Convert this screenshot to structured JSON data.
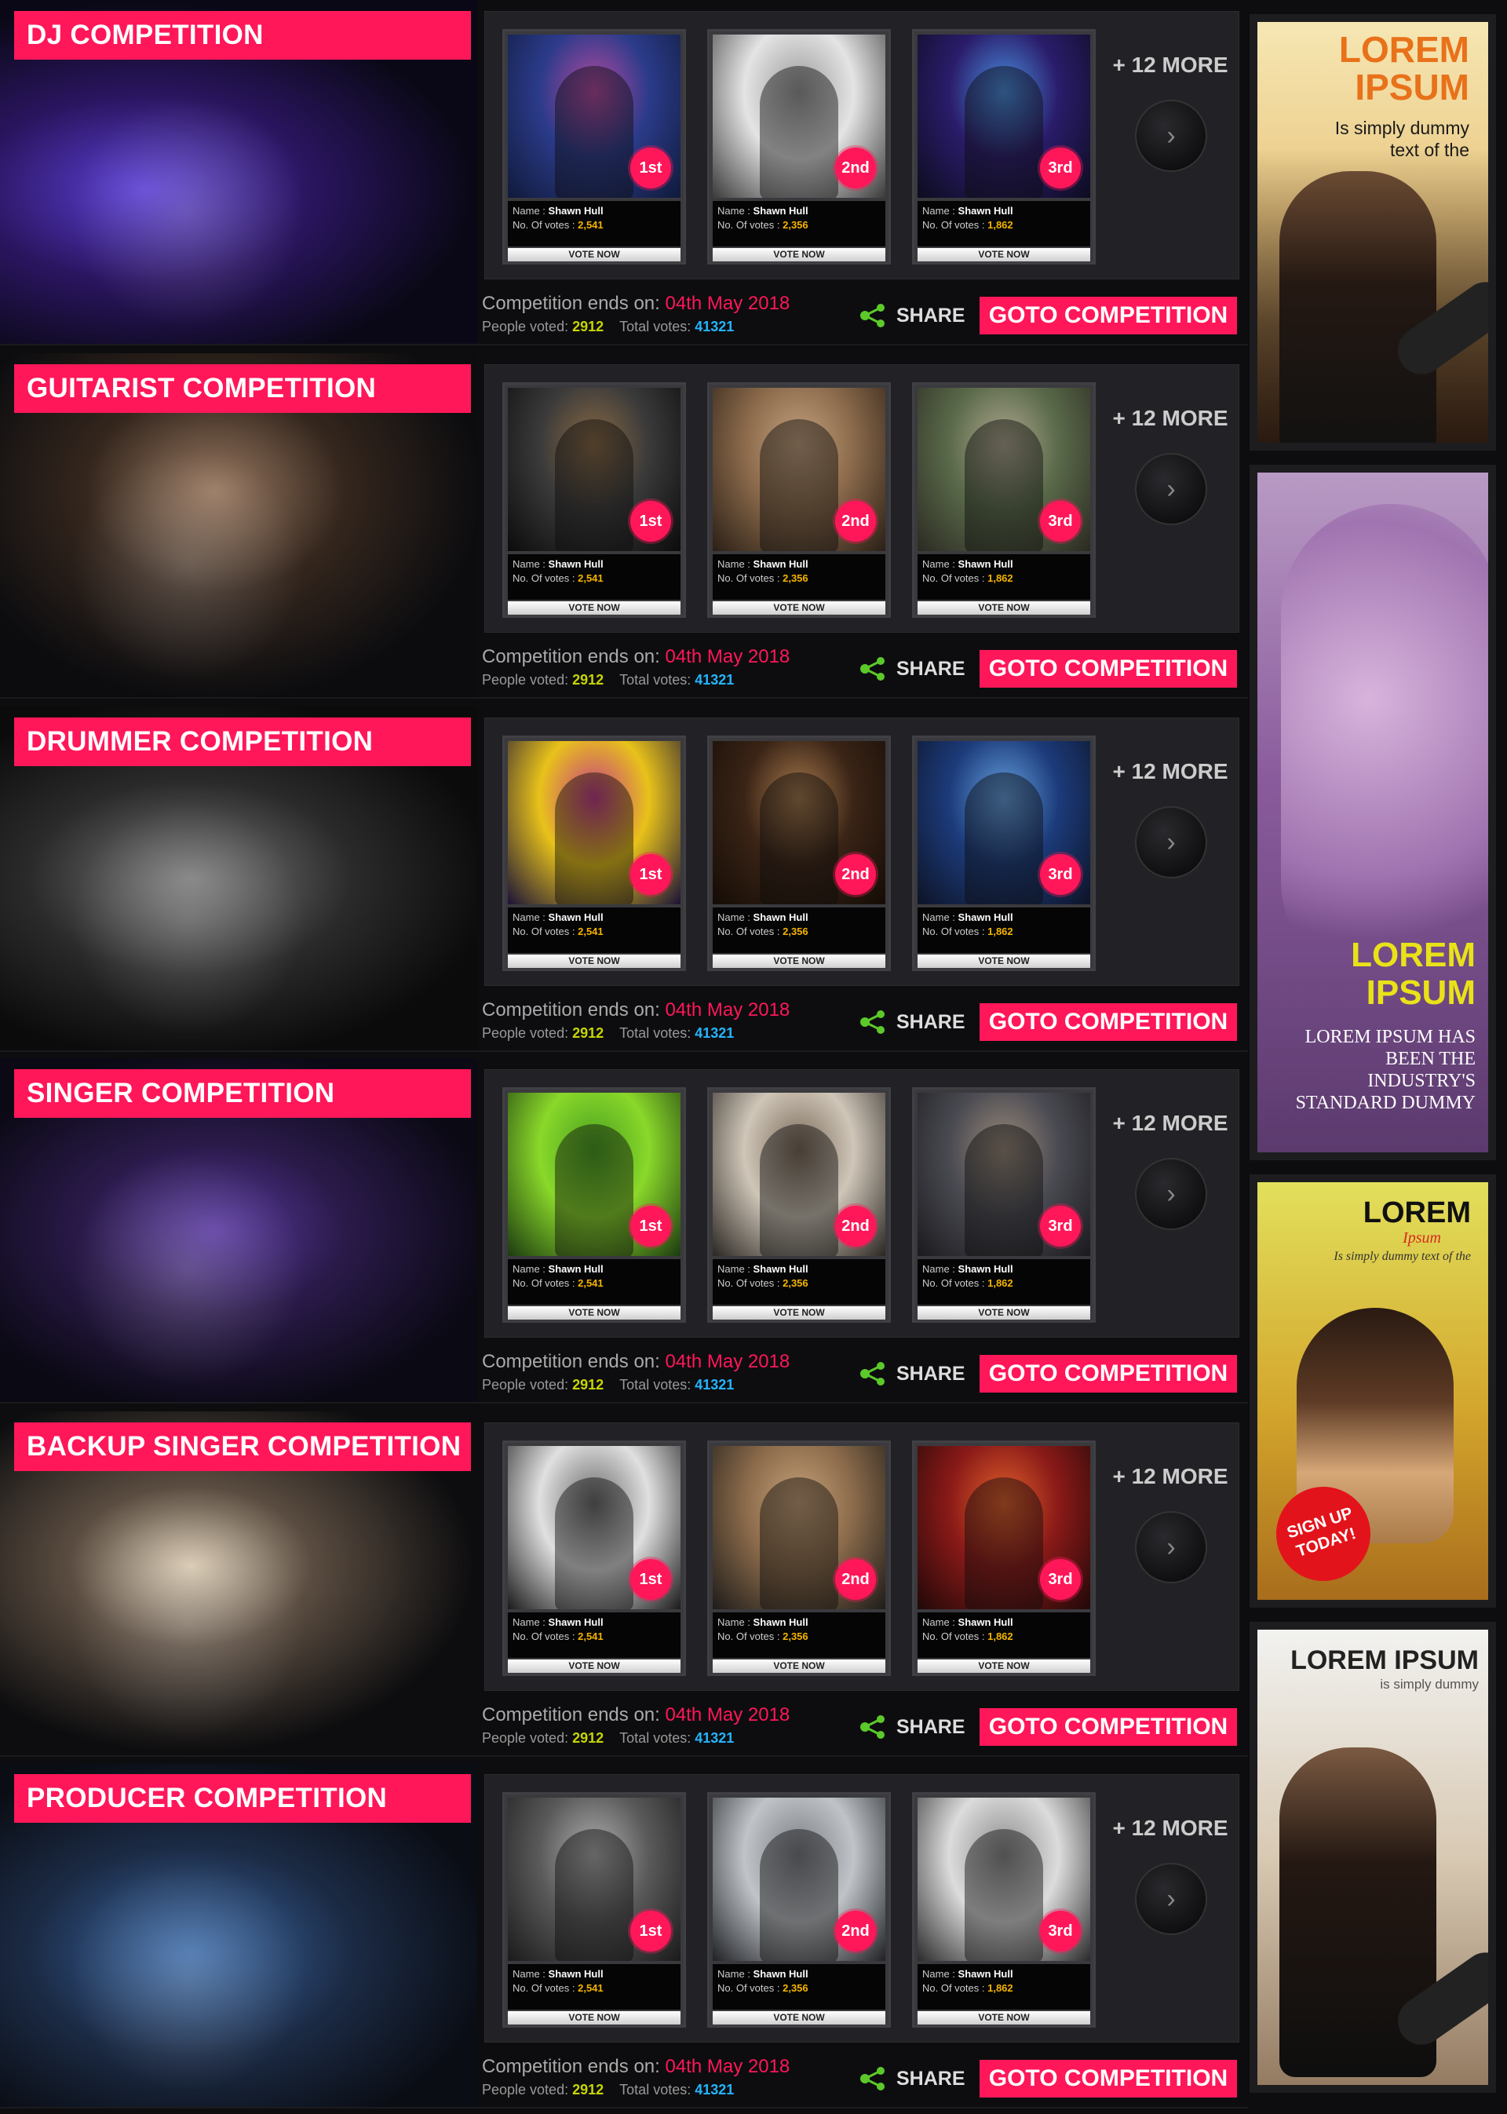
{
  "competitions": [
    {
      "title": "DJ COMPETITION",
      "cards": [
        {
          "rank": "1st",
          "name_label": "Name :",
          "name": "Shawn Hull",
          "votes_label": "No. Of votes :",
          "votes": "2,541",
          "vote_btn": "VOTE NOW"
        },
        {
          "rank": "2nd",
          "name_label": "Name :",
          "name": "Shawn Hull",
          "votes_label": "No. Of votes :",
          "votes": "2,356",
          "vote_btn": "VOTE NOW"
        },
        {
          "rank": "3rd",
          "name_label": "Name :",
          "name": "Shawn Hull",
          "votes_label": "No. Of votes :",
          "votes": "1,862",
          "vote_btn": "VOTE NOW"
        }
      ],
      "more": "+ 12 MORE",
      "ends_label": "Competition ends on:",
      "ends_date": "04th May 2018",
      "people_label": "People voted:",
      "people_voted": "2912",
      "total_label": "Total votes:",
      "total_votes": "41321",
      "share": "SHARE",
      "goto": "GOTO COMPETITION"
    },
    {
      "title": "GUITARIST COMPETITION",
      "cards": [
        {
          "rank": "1st",
          "name_label": "Name :",
          "name": "Shawn Hull",
          "votes_label": "No. Of votes :",
          "votes": "2,541",
          "vote_btn": "VOTE NOW"
        },
        {
          "rank": "2nd",
          "name_label": "Name :",
          "name": "Shawn Hull",
          "votes_label": "No. Of votes :",
          "votes": "2,356",
          "vote_btn": "VOTE NOW"
        },
        {
          "rank": "3rd",
          "name_label": "Name :",
          "name": "Shawn Hull",
          "votes_label": "No. Of votes :",
          "votes": "1,862",
          "vote_btn": "VOTE NOW"
        }
      ],
      "more": "+ 12 MORE",
      "ends_label": "Competition ends on:",
      "ends_date": "04th May 2018",
      "people_label": "People voted:",
      "people_voted": "2912",
      "total_label": "Total votes:",
      "total_votes": "41321",
      "share": "SHARE",
      "goto": "GOTO COMPETITION"
    },
    {
      "title": "DRUMMER COMPETITION",
      "cards": [
        {
          "rank": "1st",
          "name_label": "Name :",
          "name": "Shawn Hull",
          "votes_label": "No. Of votes :",
          "votes": "2,541",
          "vote_btn": "VOTE NOW"
        },
        {
          "rank": "2nd",
          "name_label": "Name :",
          "name": "Shawn Hull",
          "votes_label": "No. Of votes :",
          "votes": "2,356",
          "vote_btn": "VOTE NOW"
        },
        {
          "rank": "3rd",
          "name_label": "Name :",
          "name": "Shawn Hull",
          "votes_label": "No. Of votes :",
          "votes": "1,862",
          "vote_btn": "VOTE NOW"
        }
      ],
      "more": "+ 12 MORE",
      "ends_label": "Competition ends on:",
      "ends_date": "04th May 2018",
      "people_label": "People voted:",
      "people_voted": "2912",
      "total_label": "Total votes:",
      "total_votes": "41321",
      "share": "SHARE",
      "goto": "GOTO COMPETITION"
    },
    {
      "title": "SINGER COMPETITION",
      "cards": [
        {
          "rank": "1st",
          "name_label": "Name :",
          "name": "Shawn Hull",
          "votes_label": "No. Of votes :",
          "votes": "2,541",
          "vote_btn": "VOTE NOW"
        },
        {
          "rank": "2nd",
          "name_label": "Name :",
          "name": "Shawn Hull",
          "votes_label": "No. Of votes :",
          "votes": "2,356",
          "vote_btn": "VOTE NOW"
        },
        {
          "rank": "3rd",
          "name_label": "Name :",
          "name": "Shawn Hull",
          "votes_label": "No. Of votes :",
          "votes": "1,862",
          "vote_btn": "VOTE NOW"
        }
      ],
      "more": "+ 12 MORE",
      "ends_label": "Competition ends on:",
      "ends_date": "04th May 2018",
      "people_label": "People voted:",
      "people_voted": "2912",
      "total_label": "Total votes:",
      "total_votes": "41321",
      "share": "SHARE",
      "goto": "GOTO COMPETITION"
    },
    {
      "title": "BACKUP SINGER COMPETITION",
      "cards": [
        {
          "rank": "1st",
          "name_label": "Name :",
          "name": "Shawn Hull",
          "votes_label": "No. Of votes :",
          "votes": "2,541",
          "vote_btn": "VOTE NOW"
        },
        {
          "rank": "2nd",
          "name_label": "Name :",
          "name": "Shawn Hull",
          "votes_label": "No. Of votes :",
          "votes": "2,356",
          "vote_btn": "VOTE NOW"
        },
        {
          "rank": "3rd",
          "name_label": "Name :",
          "name": "Shawn Hull",
          "votes_label": "No. Of votes :",
          "votes": "1,862",
          "vote_btn": "VOTE NOW"
        }
      ],
      "more": "+ 12 MORE",
      "ends_label": "Competition ends on:",
      "ends_date": "04th May 2018",
      "people_label": "People voted:",
      "people_voted": "2912",
      "total_label": "Total votes:",
      "total_votes": "41321",
      "share": "SHARE",
      "goto": "GOTO COMPETITION"
    },
    {
      "title": "PRODUCER COMPETITION",
      "cards": [
        {
          "rank": "1st",
          "name_label": "Name :",
          "name": "Shawn Hull",
          "votes_label": "No. Of votes :",
          "votes": "2,541",
          "vote_btn": "VOTE NOW"
        },
        {
          "rank": "2nd",
          "name_label": "Name :",
          "name": "Shawn Hull",
          "votes_label": "No. Of votes :",
          "votes": "2,356",
          "vote_btn": "VOTE NOW"
        },
        {
          "rank": "3rd",
          "name_label": "Name :",
          "name": "Shawn Hull",
          "votes_label": "No. Of votes :",
          "votes": "1,862",
          "vote_btn": "VOTE NOW"
        }
      ],
      "more": "+ 12 MORE",
      "ends_label": "Competition ends on:",
      "ends_date": "04th May 2018",
      "people_label": "People voted:",
      "people_voted": "2912",
      "total_label": "Total votes:",
      "total_votes": "41321",
      "share": "SHARE",
      "goto": "GOTO COMPETITION"
    }
  ],
  "ads": {
    "ad1": {
      "headline_1": "LOREM",
      "headline_2": "IPSUM",
      "sub_1": "Is simply dummy",
      "sub_2": "text of the"
    },
    "ad2": {
      "headline_1": "LOREM",
      "headline_2": "IPSUM",
      "body_1": "LOREM IPSUM HAS",
      "body_2": "BEEN THE",
      "body_3": "INDUSTRY'S",
      "body_4": "STANDARD DUMMY"
    },
    "ad3": {
      "headline": "LOREM",
      "script": "Ipsum",
      "sub": "Is simply dummy text of the",
      "badge_1": "SIGN UP",
      "badge_2": "TODAY!"
    },
    "ad4": {
      "headline": "LOREM IPSUM",
      "sub": "is simply dummy"
    }
  },
  "colors": {
    "accent": "#ff1759",
    "people_voted": "#c7d600",
    "total_votes": "#24b5ff",
    "vote_count": "#f5b400",
    "share_icon": "#5cc92a"
  },
  "icons": [
    "share-icon",
    "chevron-right-icon",
    "rank-badge-icon"
  ]
}
